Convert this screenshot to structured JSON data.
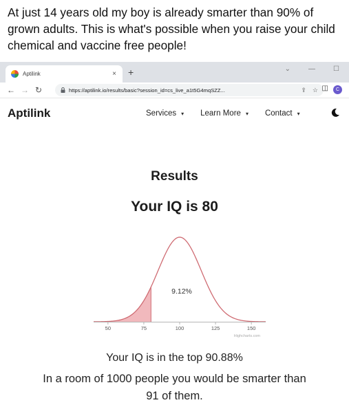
{
  "post": {
    "caption": "At just 14 years old my boy is already smarter than 90% of grown adults. This is what's possible when you raise your child chemical and vaccine free people!"
  },
  "browser": {
    "tab_title": "Aptilink",
    "tab_close": "×",
    "new_tab": "+",
    "url": "https://aptilink.io/results/basic?session_id=cs_live_a1t5G4mqSZZ...",
    "profile_initial": "C"
  },
  "site": {
    "brand": "Aptilink",
    "nav": [
      "Services",
      "Learn More",
      "Contact"
    ]
  },
  "results": {
    "title": "Results",
    "iq_text": "Your IQ is 80",
    "top_text": "Your IQ is in the top 90.88%",
    "room_text_1": "In a room of 1000 people you would be smarter than",
    "room_text_2": "91 of them."
  },
  "chart_data": {
    "type": "area",
    "x_ticks": [
      "50",
      "75",
      "100",
      "125",
      "150"
    ],
    "xlim": [
      40,
      160
    ],
    "distribution": {
      "mean": 100,
      "sd": 15
    },
    "shaded_below": 80,
    "shaded_label": "9.12%",
    "credit": "Highcharts.com",
    "colors": {
      "curve": "#cf6b72",
      "fill": "#f1b9bd",
      "axis": "#b5b5b5"
    }
  }
}
